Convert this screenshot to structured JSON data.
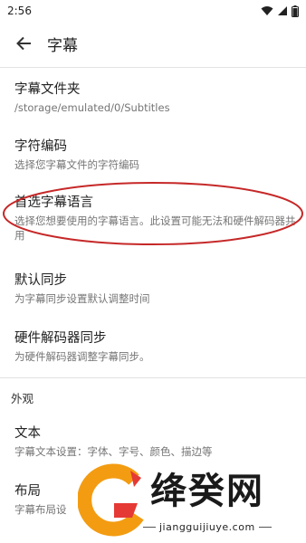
{
  "status_bar": {
    "time": "2:56",
    "icons": [
      "wifi-icon",
      "signal-icon",
      "battery-icon"
    ]
  },
  "app_bar": {
    "back_icon": "arrow-back-icon",
    "title": "字幕"
  },
  "preferences": [
    {
      "title": "字幕文件夹",
      "summary": "/storage/emulated/0/Subtitles"
    },
    {
      "title": "字符编码",
      "summary": "选择您字幕文件的字符编码"
    },
    {
      "title": "首选字幕语言",
      "summary": "选择您想要使用的字幕语言。此设置可能无法和硬件解码器共用"
    },
    {
      "title": "默认同步",
      "summary": "为字幕同步设置默认调整时间"
    },
    {
      "title": "硬件解码器同步",
      "summary": "为硬件解码器调整字幕同步。"
    }
  ],
  "section_appearance": {
    "header": "外观",
    "items": [
      {
        "title": "文本",
        "summary": "字幕文本设置：字体、字号、颜色、描边等"
      },
      {
        "title": "布局",
        "summary": "字幕布局设"
      }
    ]
  },
  "highlight_color": "#c62828",
  "watermark": {
    "brand": "绛癸网",
    "url": "jiangguijiuye.com",
    "colors": {
      "orange": "#f39c12",
      "red": "#e53935",
      "dark": "#1a1a1a"
    }
  }
}
